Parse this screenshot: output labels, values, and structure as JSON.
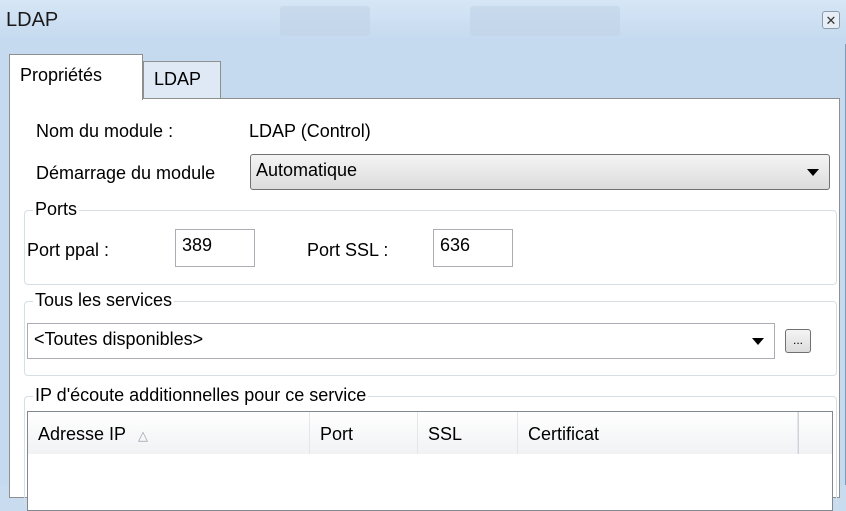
{
  "window": {
    "title": "LDAP"
  },
  "tabs": [
    {
      "label": "Propriétés",
      "active": true
    },
    {
      "label": "LDAP",
      "active": false
    }
  ],
  "module": {
    "name_label": "Nom du module :",
    "name_value": "LDAP (Control)",
    "startup_label": "Démarrage du module",
    "startup_value": "Automatique"
  },
  "ports": {
    "group_label": "Ports",
    "main_label": "Port ppal :",
    "main_value": "389",
    "ssl_label": "Port SSL :",
    "ssl_value": "636"
  },
  "services": {
    "group_label": "Tous les services",
    "value": "<Toutes disponibles>",
    "browse_label": "..."
  },
  "listen_ips": {
    "group_label": "IP d'écoute additionnelles pour ce service",
    "columns": [
      "Adresse IP",
      "Port",
      "SSL",
      "Certificat"
    ],
    "rows": []
  },
  "icons": {
    "close": "close-icon",
    "sort": "sort-ascending-icon",
    "dropdown": "chevron-down-icon"
  }
}
